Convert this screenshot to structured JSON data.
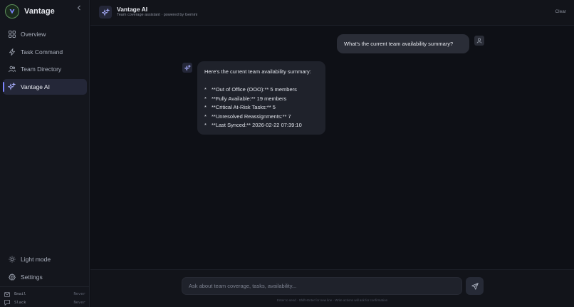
{
  "app": {
    "name": "Vantage"
  },
  "sidebar": {
    "items": [
      {
        "label": "Overview",
        "icon": "grid-icon",
        "active": false
      },
      {
        "label": "Task Command",
        "icon": "bolt-icon",
        "active": false
      },
      {
        "label": "Team Directory",
        "icon": "users-icon",
        "active": false
      },
      {
        "label": "Vantage AI",
        "icon": "sparkles-icon",
        "active": true
      }
    ],
    "bottom": [
      {
        "label": "Light mode",
        "icon": "sun-icon"
      },
      {
        "label": "Settings",
        "icon": "gear-icon"
      }
    ],
    "integrations": [
      {
        "label": "Email",
        "status": "Never",
        "icon": "mail-icon"
      },
      {
        "label": "Slack",
        "status": "Never",
        "icon": "chat-icon"
      }
    ]
  },
  "header": {
    "title": "Vantage AI",
    "subtitle": "Team coverage assistant · powered by Gemini",
    "clear_label": "Clear"
  },
  "chat": {
    "user_message": "What's the current team availability summary?",
    "ai_intro": "Here's the current team availability summary:",
    "ai_bullets": [
      "**Out of Office (OOO):** 5 members",
      "**Fully Available:** 19 members",
      "**Critical At-Risk Tasks:** 5",
      "**Unresolved Reassignments:** 7",
      "**Last Synced:** 2026-02-22 07:39:10"
    ]
  },
  "composer": {
    "placeholder": "Ask about team coverage, tasks, availability...",
    "hint": "Enter to send · Shift+Enter for new line · Write actions will ask for confirmation"
  },
  "colors": {
    "accent": "#7c84ff",
    "brand": "#5d8f5a",
    "background": "#0e1016"
  }
}
